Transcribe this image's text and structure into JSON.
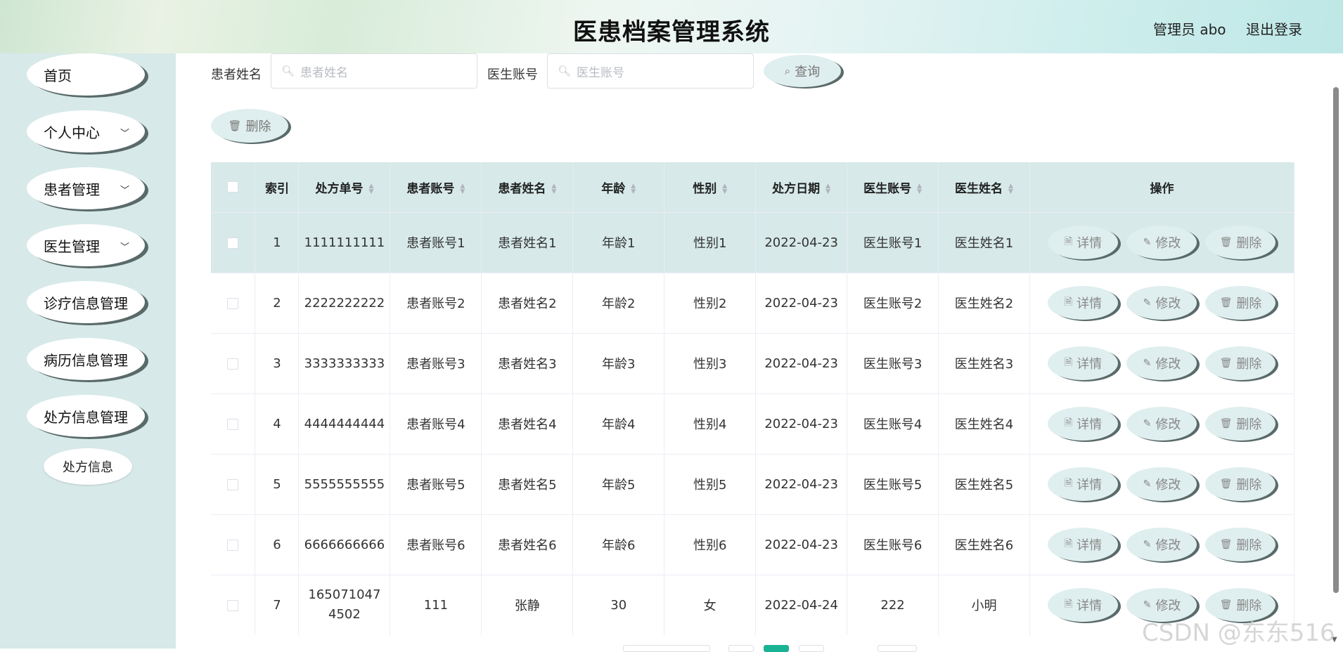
{
  "header": {
    "title": "医患档案管理系统",
    "user": "管理员 abo",
    "logout": "退出登录"
  },
  "sidebar": {
    "items": [
      {
        "label": "首页"
      },
      {
        "label": "个人中心"
      },
      {
        "label": "患者管理"
      },
      {
        "label": "医生管理"
      },
      {
        "label": "诊疗信息管理"
      },
      {
        "label": "病历信息管理"
      },
      {
        "label": "处方信息管理"
      }
    ],
    "sub_item": "处方信息"
  },
  "search": {
    "patient_label": "患者姓名",
    "patient_placeholder": "患者姓名",
    "doctor_label": "医生账号",
    "doctor_placeholder": "医生账号",
    "query_button": "查询"
  },
  "toolbar": {
    "delete_button": "删除"
  },
  "table": {
    "headers": [
      "索引",
      "处方单号",
      "患者账号",
      "患者姓名",
      "年龄",
      "性别",
      "处方日期",
      "医生账号",
      "医生姓名",
      "操作"
    ],
    "actions": {
      "detail": "详情",
      "edit": "修改",
      "delete": "删除"
    },
    "rows": [
      {
        "index": "1",
        "no": "1111111111",
        "patient_account": "患者账号1",
        "patient_name": "患者姓名1",
        "age": "年龄1",
        "gender": "性别1",
        "date": "2022-04-23",
        "doctor_account": "医生账号1",
        "doctor_name": "医生姓名1"
      },
      {
        "index": "2",
        "no": "2222222222",
        "patient_account": "患者账号2",
        "patient_name": "患者姓名2",
        "age": "年龄2",
        "gender": "性别2",
        "date": "2022-04-23",
        "doctor_account": "医生账号2",
        "doctor_name": "医生姓名2"
      },
      {
        "index": "3",
        "no": "3333333333",
        "patient_account": "患者账号3",
        "patient_name": "患者姓名3",
        "age": "年龄3",
        "gender": "性别3",
        "date": "2022-04-23",
        "doctor_account": "医生账号3",
        "doctor_name": "医生姓名3"
      },
      {
        "index": "4",
        "no": "4444444444",
        "patient_account": "患者账号4",
        "patient_name": "患者姓名4",
        "age": "年龄4",
        "gender": "性别4",
        "date": "2022-04-23",
        "doctor_account": "医生账号4",
        "doctor_name": "医生姓名4"
      },
      {
        "index": "5",
        "no": "5555555555",
        "patient_account": "患者账号5",
        "patient_name": "患者姓名5",
        "age": "年龄5",
        "gender": "性别5",
        "date": "2022-04-23",
        "doctor_account": "医生账号5",
        "doctor_name": "医生姓名5"
      },
      {
        "index": "6",
        "no": "6666666666",
        "patient_account": "患者账号6",
        "patient_name": "患者姓名6",
        "age": "年龄6",
        "gender": "性别6",
        "date": "2022-04-23",
        "doctor_account": "医生账号6",
        "doctor_name": "医生姓名6"
      },
      {
        "index": "7",
        "no": "1650710474502",
        "patient_account": "111",
        "patient_name": "张静",
        "age": "30",
        "gender": "女",
        "date": "2022-04-24",
        "doctor_account": "222",
        "doctor_name": "小明"
      }
    ]
  },
  "watermark": "CSDN @东东516",
  "icons": {
    "search": "search-icon",
    "delete": "trash-icon",
    "detail": "document-icon",
    "edit": "pencil-icon",
    "chevron": "chevron-down-icon"
  }
}
